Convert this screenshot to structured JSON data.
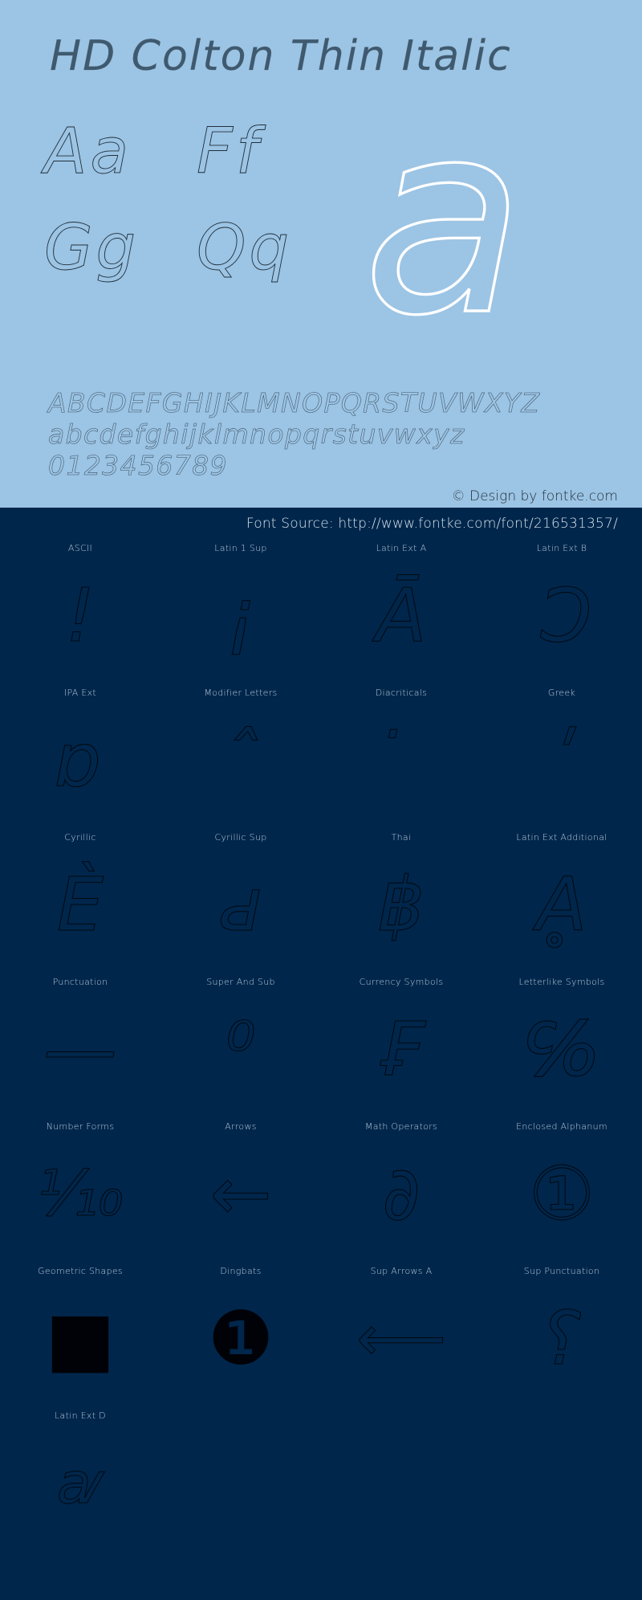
{
  "specimen": {
    "title": "HD Colton Thin Italic",
    "hero_glyph": "a",
    "letter_pairs": [
      {
        "name": "Aa",
        "text": "Aa"
      },
      {
        "name": "Ff",
        "text": "Ff"
      },
      {
        "name": "Gg",
        "text": "Gg"
      },
      {
        "name": "Qq",
        "text": "Qq"
      }
    ],
    "alphabet_uppercase": "ABCDEFGHIJKLMNOPQRSTUVWXYZ",
    "alphabet_lowercase": "abcdefghijklmnopqrstuvwxyz",
    "digits": "0123456789",
    "copyright": "© Design by fontke.com",
    "font_source": "Font Source: http://www.fontke.com/font/216531357/"
  },
  "colors": {
    "light_panel": "#9cc4e4",
    "dark_panel": "#00264b",
    "hero_stroke": "#ffffff",
    "label_text": "#b9cbdb"
  },
  "unicode_blocks": [
    {
      "label": "ASCII",
      "glyph": "!",
      "size": "normal"
    },
    {
      "label": "Latin 1 Sup",
      "glyph": "¡",
      "size": "normal"
    },
    {
      "label": "Latin Ext A",
      "glyph": "Ā",
      "size": "normal"
    },
    {
      "label": "Latin Ext B",
      "glyph": "Ɔ",
      "size": "normal"
    },
    {
      "label": "IPA Ext",
      "glyph": "ɒ",
      "size": "normal"
    },
    {
      "label": "Modifier Letters",
      "glyph": "ˆ",
      "size": "normal"
    },
    {
      "label": "Diacriticals",
      "glyph": "̇",
      "size": "normal"
    },
    {
      "label": "Greek",
      "glyph": "ʹ",
      "size": "normal"
    },
    {
      "label": "Cyrillic",
      "glyph": "Ѐ",
      "size": "normal"
    },
    {
      "label": "Cyrillic Sup",
      "glyph": "ԁ",
      "size": "normal"
    },
    {
      "label": "Thai",
      "glyph": "฿",
      "size": "normal"
    },
    {
      "label": "Latin Ext Additional",
      "glyph": "Ḁ",
      "size": "normal"
    },
    {
      "label": "Punctuation",
      "glyph": "—",
      "size": "normal"
    },
    {
      "label": "Super And Sub",
      "glyph": "⁰",
      "size": "normal"
    },
    {
      "label": "Currency Symbols",
      "glyph": "₣",
      "size": "normal"
    },
    {
      "label": "Letterlike Symbols",
      "glyph": "℅",
      "size": "normal"
    },
    {
      "label": "Number Forms",
      "glyph": "⅒",
      "size": "wide"
    },
    {
      "label": "Arrows",
      "glyph": "←",
      "size": "normal"
    },
    {
      "label": "Math Operators",
      "glyph": "∂",
      "size": "normal"
    },
    {
      "label": "Enclosed Alphanum",
      "glyph": "①",
      "size": "normal"
    },
    {
      "label": "Geometric Shapes",
      "glyph": "■",
      "size": "solid"
    },
    {
      "label": "Dingbats",
      "glyph": "❶",
      "size": "solid"
    },
    {
      "label": "Sup Arrows A",
      "glyph": "⟵",
      "size": "wide"
    },
    {
      "label": "Sup Punctuation",
      "glyph": "⸮",
      "size": "normal"
    },
    {
      "label": "Latin Ext D",
      "glyph": "ꜹ",
      "size": "small"
    }
  ]
}
